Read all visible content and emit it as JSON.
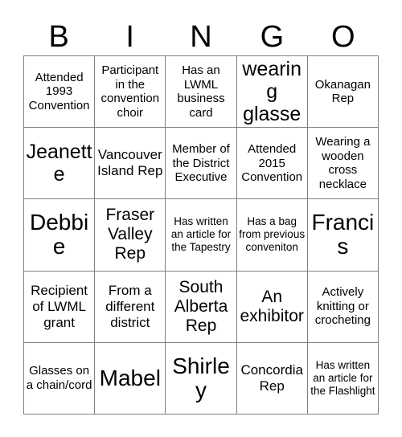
{
  "card": {
    "title": "BINGO",
    "header_letters": [
      "B",
      "I",
      "N",
      "G",
      "O"
    ],
    "grid_size": 5,
    "border_color": "#808080",
    "text_color": "#000000",
    "background_color": "#ffffff",
    "rows": [
      [
        {
          "text": "Attended 1993 Convention",
          "size": "s"
        },
        {
          "text": "Participant in the convention choir",
          "size": "s"
        },
        {
          "text": "Has an LWML business card",
          "size": "s"
        },
        {
          "text": "Not wearing glasses",
          "size": "xl"
        },
        {
          "text": "Okanagan Rep",
          "size": "s"
        }
      ],
      [
        {
          "text": "Jeanette",
          "size": "xl"
        },
        {
          "text": "Vancouver Island Rep",
          "size": "m"
        },
        {
          "text": "Member of the District Executive",
          "size": "s"
        },
        {
          "text": "Attended 2015 Convention",
          "size": "s"
        },
        {
          "text": "Wearing a wooden cross necklace",
          "size": "s"
        }
      ],
      [
        {
          "text": "Debbie",
          "size": "xxl"
        },
        {
          "text": "Fraser Valley Rep",
          "size": "l"
        },
        {
          "text": "Has written an article for the Tapestry",
          "size": "xs"
        },
        {
          "text": "Has a bag from previous conveniton",
          "size": "xs"
        },
        {
          "text": "Francis",
          "size": "xxl"
        }
      ],
      [
        {
          "text": "Recipient of LWML grant",
          "size": "m"
        },
        {
          "text": "From a different district",
          "size": "m"
        },
        {
          "text": "South Alberta Rep",
          "size": "l"
        },
        {
          "text": "An exhibitor",
          "size": "l"
        },
        {
          "text": "Actively knitting or crocheting",
          "size": "s"
        }
      ],
      [
        {
          "text": "Glasses on a chain/cord",
          "size": "s"
        },
        {
          "text": "Mabel",
          "size": "xxl"
        },
        {
          "text": "Shirley",
          "size": "xxl"
        },
        {
          "text": "Concordia Rep",
          "size": "m"
        },
        {
          "text": "Has written an article for the Flashlight",
          "size": "xs"
        }
      ]
    ]
  }
}
